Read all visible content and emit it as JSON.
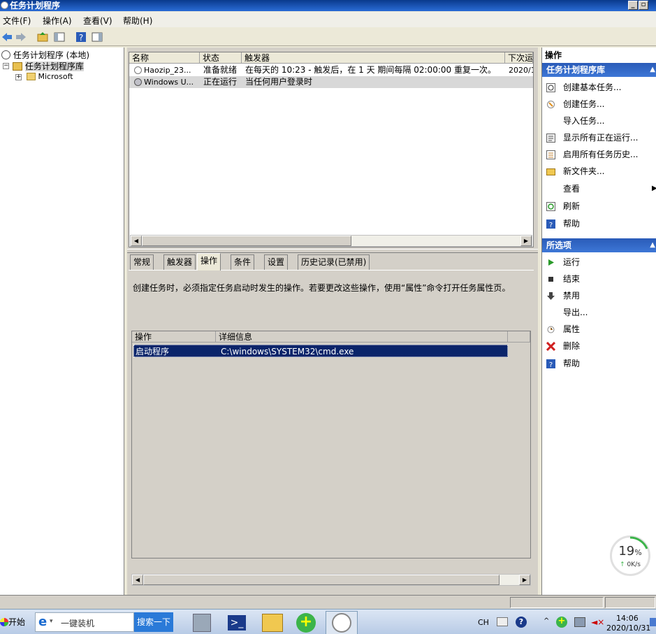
{
  "window": {
    "title": "任务计划程序"
  },
  "menu": [
    "文件(F)",
    "操作(A)",
    "查看(V)",
    "帮助(H)"
  ],
  "tree": {
    "root": "任务计划程序 (本地)",
    "library": "任务计划程序库",
    "child": "Microsoft"
  },
  "tasklist": {
    "columns": [
      "名称",
      "状态",
      "触发器",
      "下次运"
    ],
    "rows": [
      {
        "name": "Haozip_23...",
        "status": "准备就绪",
        "trigger": "在每天的 10:23 - 触发后，在 1 天 期间每隔 02:00:00 重复一次。",
        "next": "2020/1"
      },
      {
        "name": "Windows U...",
        "status": "正在运行",
        "trigger": "当任何用户登录时",
        "next": ""
      }
    ]
  },
  "detail": {
    "tabs": [
      "常规",
      "触发器",
      "操作",
      "条件",
      "设置",
      "历史记录(已禁用)"
    ],
    "active_tab": "操作",
    "description": "创建任务时，必须指定任务启动时发生的操作。若要更改这些操作，使用“属性”命令打开任务属性页。",
    "columns": [
      "操作",
      "详细信息"
    ],
    "rows": [
      {
        "action": "启动程序",
        "detail": "C:\\windows\\SYSTEM32\\cmd.exe"
      }
    ]
  },
  "actions": {
    "header": "操作",
    "section1": {
      "title": "任务计划程序库",
      "items": [
        {
          "label": "创建基本任务...",
          "icon": "create-basic-task-icon"
        },
        {
          "label": "创建任务...",
          "icon": "create-task-icon"
        },
        {
          "label": "导入任务...",
          "icon": ""
        },
        {
          "label": "显示所有正在运行...",
          "icon": "running-tasks-icon"
        },
        {
          "label": "启用所有任务历史...",
          "icon": "history-icon"
        },
        {
          "label": "新文件夹...",
          "icon": "folder-icon"
        },
        {
          "label": "查看",
          "icon": ""
        },
        {
          "label": "刷新",
          "icon": "refresh-icon"
        },
        {
          "label": "帮助",
          "icon": "help-icon"
        }
      ]
    },
    "section2": {
      "title": "所选项",
      "items": [
        {
          "label": "运行",
          "icon": "run-icon"
        },
        {
          "label": "结束",
          "icon": "end-icon"
        },
        {
          "label": "禁用",
          "icon": "disable-icon"
        },
        {
          "label": "导出...",
          "icon": ""
        },
        {
          "label": "属性",
          "icon": "properties-icon"
        },
        {
          "label": "删除",
          "icon": "delete-icon"
        },
        {
          "label": "帮助",
          "icon": "help-icon"
        }
      ]
    }
  },
  "gauge": {
    "percent": "19",
    "unit": "%",
    "speed": "0K/s"
  },
  "taskbar": {
    "start": "开始",
    "search_placeholder": "一键装机",
    "search_button": "搜索一下",
    "lang": "CH",
    "time": "14:06",
    "date": "2020/10/31"
  },
  "colors": {
    "accent": "#2a5bb8",
    "selection": "#0a246a"
  }
}
